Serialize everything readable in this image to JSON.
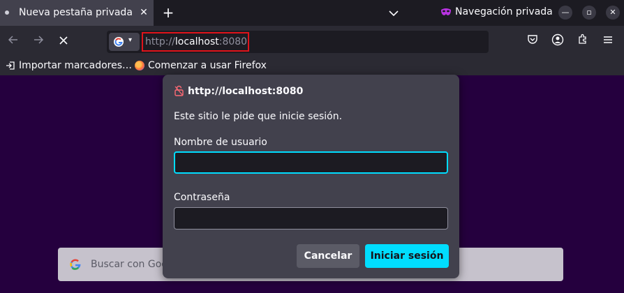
{
  "tab": {
    "title": "Nueva pestaña privada",
    "close": "✕"
  },
  "tabbar": {
    "new_tab": "+",
    "private_label": "Navegación privada",
    "minimize": "—",
    "restore": "▫",
    "close": "✕"
  },
  "urlbar": {
    "scheme": "http://",
    "host": "localhost",
    "port": ":8080"
  },
  "bookmarks": [
    {
      "label": "Importar marcadores…"
    },
    {
      "label": "Comenzar a usar Firefox"
    }
  ],
  "search": {
    "placeholder": "Buscar con Goo"
  },
  "dialog": {
    "origin": "http://localhost:8080",
    "message": "Este sitio le pide que inicie sesión.",
    "username_label": "Nombre de usuario",
    "username_value": "",
    "password_label": "Contraseña",
    "password_value": "",
    "cancel_label": "Cancelar",
    "submit_label": "Iniciar sesión"
  },
  "colors": {
    "accent": "#00ddff",
    "private": "#b833e1",
    "page_bg": "#25003e",
    "highlight": "#e0131a"
  }
}
